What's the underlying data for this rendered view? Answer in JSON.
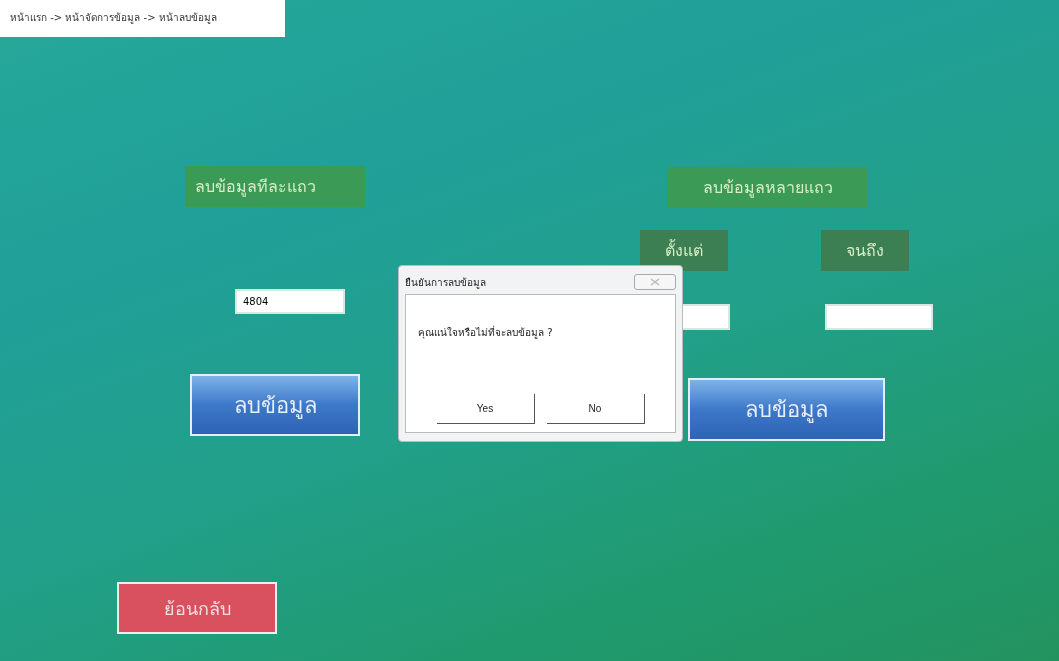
{
  "breadcrumb": "หน้าแรก -> หน้าจัดการข้อมูล -> หน้าลบข้อมูล",
  "single_delete": {
    "title": "ลบข้อมูลทีละแถว",
    "value": "4804",
    "button": "ลบข้อมูล"
  },
  "range_delete": {
    "title": "ลบข้อมูลหลายแถว",
    "from_label": "ตั้งแต่",
    "to_label": "จนถึง",
    "button": "ลบข้อมูล"
  },
  "back_button": "ย้อนกลับ",
  "dialog": {
    "title": "ยืนยันการลบข้อมูล",
    "message": "คุณแน่ใจหรือไม่ที่จะลบข้อมูล ?",
    "buttons": [
      "Yes",
      "No"
    ]
  }
}
